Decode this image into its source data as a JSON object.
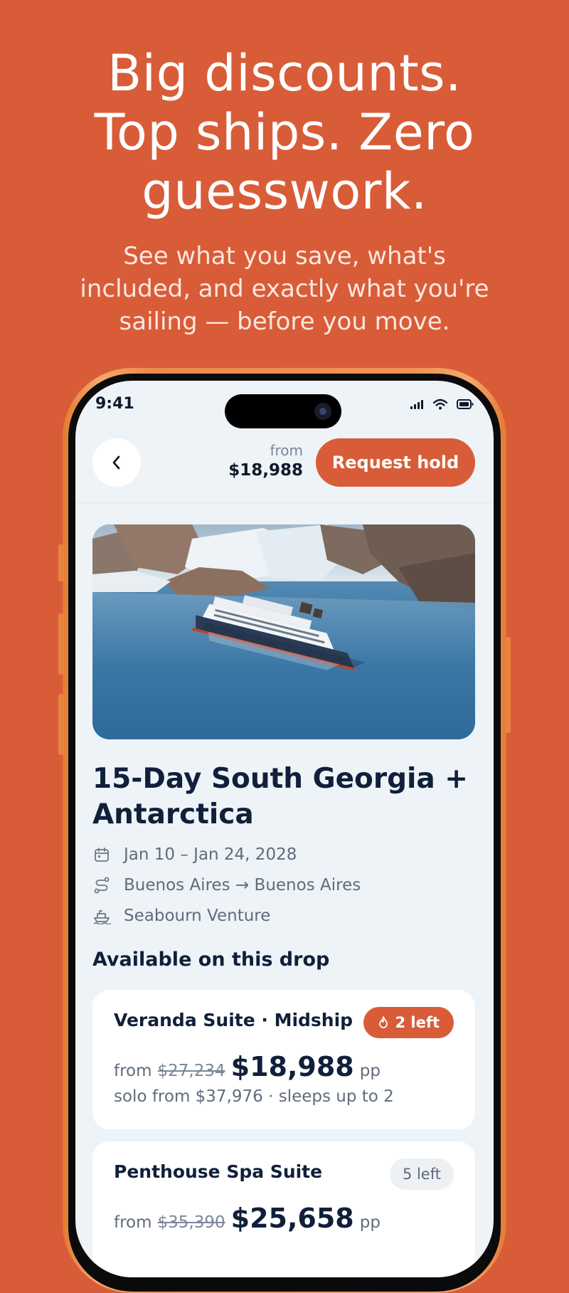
{
  "promo": {
    "headline_line1": "Big discounts.",
    "headline_line2": "Top ships. Zero",
    "headline_line3": "guesswork.",
    "subhead_line1": "See what you save, what's",
    "subhead_line2": "included, and exactly what you're",
    "subhead_line3": "sailing — before you move.",
    "colors": {
      "background": "#D95C38",
      "accent": "#D95C38",
      "ink": "#10203A"
    }
  },
  "status_bar": {
    "time": "9:41",
    "icons": [
      "cellular-icon",
      "wifi-icon",
      "battery-icon"
    ]
  },
  "header": {
    "back_icon": "chevron-left-icon",
    "price_prefix": "from",
    "price": "$18,988",
    "action_label": "Request hold"
  },
  "trip": {
    "title_line1": "15-Day South Georgia +",
    "title_line2": "Antarctica",
    "dates": "Jan 10 – Jan 24, 2028",
    "route": "Buenos Aires → Buenos Aires",
    "ship": "Seabourn Venture",
    "meta_icons": [
      "calendar-icon",
      "route-icon",
      "ship-icon"
    ]
  },
  "cabins": {
    "section_title": "Available on this drop",
    "items": [
      {
        "name": "Veranda Suite · Midship",
        "badge": "2 left",
        "badge_icon": "flame-icon",
        "from_label": "from",
        "old_price": "$27,234",
        "price": "$18,988",
        "per": "pp",
        "details": "solo from $37,976 · sleeps up to 2"
      },
      {
        "name": "Penthouse Spa Suite",
        "badge": "5 left",
        "from_label": "from",
        "old_price": "$35,390",
        "price": "$25,658",
        "per": "pp"
      }
    ]
  }
}
